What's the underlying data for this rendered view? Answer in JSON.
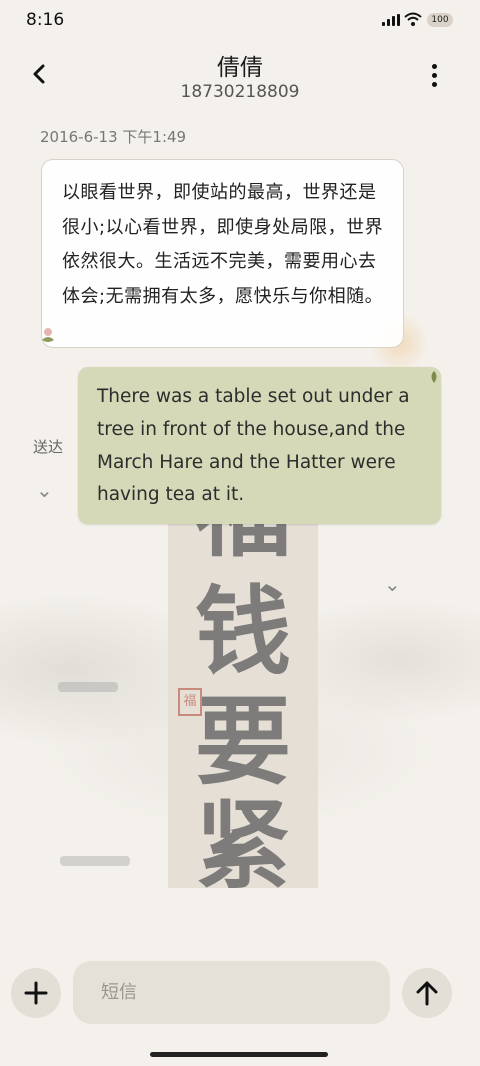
{
  "status_bar": {
    "time": "8:16",
    "battery": "100",
    "icons": [
      "signal-icon",
      "wifi-icon",
      "battery-icon"
    ]
  },
  "header": {
    "contact_name": "倩倩",
    "contact_number": "18730218809",
    "icons": [
      "back-arrow-icon",
      "more-vertical-icon"
    ]
  },
  "conversation": {
    "timestamp": "2016-6-13 下午1:49",
    "messages": [
      {
        "direction": "incoming",
        "text": "以眼看世界，即使站的最高，世界还是很小;以心看世界，即使身处局限，世界依然很大。生活远不完美，需要用心去体会;无需拥有太多，愿快乐与你相随。"
      },
      {
        "direction": "outgoing",
        "text": "There was a table set out under a tree in front of the house,and the March Hare and the Hatter were having tea at it.",
        "status": "送达"
      }
    ]
  },
  "composer": {
    "placeholder": "短信",
    "icons": [
      "plus-icon",
      "send-arrow-icon"
    ]
  },
  "colors": {
    "background": "#f4f1ec",
    "incoming_bubble": "#ffffff",
    "outgoing_bubble": "#d5d9b8"
  }
}
